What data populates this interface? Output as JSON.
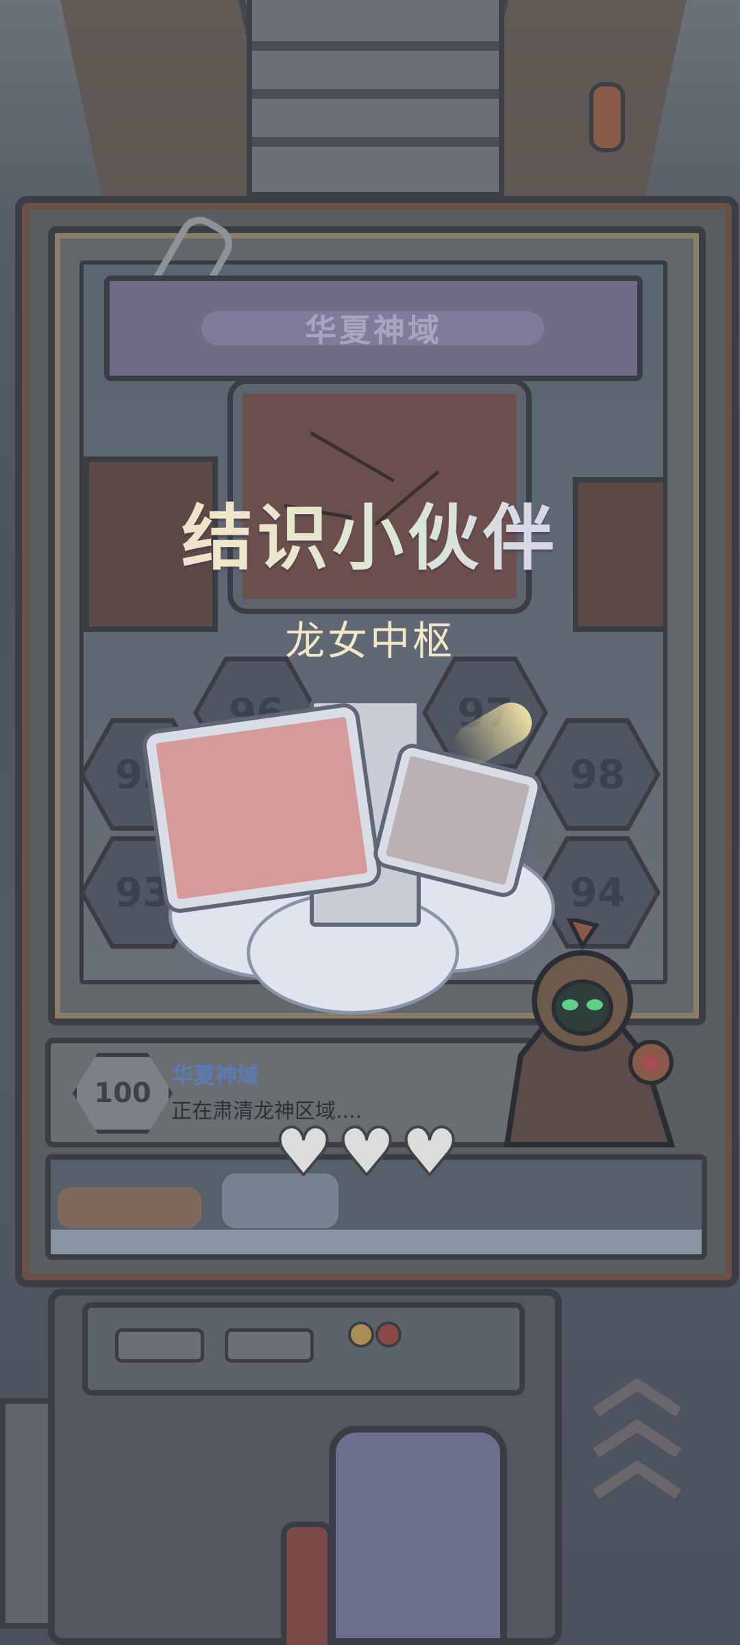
{
  "screen": "partner-unlock",
  "region_banner": {
    "label": "华夏神域"
  },
  "title": "结识小伙伴",
  "subtitle": "龙女中枢",
  "level_tiles": [
    "96",
    "97",
    "95",
    "98",
    "93",
    "94"
  ],
  "stage_info": {
    "level": "100",
    "zone_name": "华夏神域",
    "status": "正在肃清龙神区域...."
  },
  "lives": {
    "count": 3,
    "icon": "heart-icon"
  },
  "colors": {
    "title_gradient": [
      "#e8c8d8",
      "#f0e6c8",
      "#d9e8d4",
      "#d8d0ee"
    ],
    "subtitle": "#f2e7c9",
    "zone_name": "#5a7bb4"
  }
}
